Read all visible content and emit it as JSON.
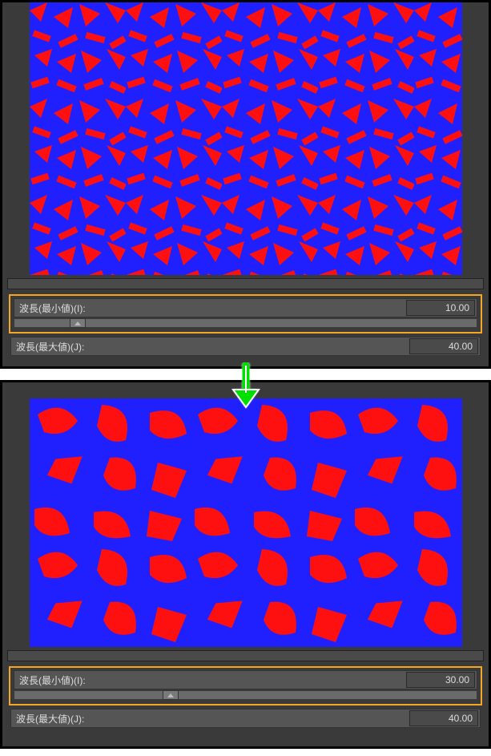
{
  "colors": {
    "pattern_bg": "#2020ff",
    "pattern_fg": "#ff1010",
    "panel_bg": "#3a3a3a",
    "highlight": "#f5a623",
    "arrow": "#00e000"
  },
  "top": {
    "param1": {
      "label": "波長(最小値)(I):",
      "value": "10.00",
      "thumb_percent": 12
    },
    "param2": {
      "label": "波長(最大値)(J):",
      "value": "40.00"
    }
  },
  "bottom": {
    "param1": {
      "label": "波長(最小値)(I):",
      "value": "30.00",
      "thumb_percent": 32
    },
    "param2": {
      "label": "波長(最大値)(J):",
      "value": "40.00"
    }
  }
}
